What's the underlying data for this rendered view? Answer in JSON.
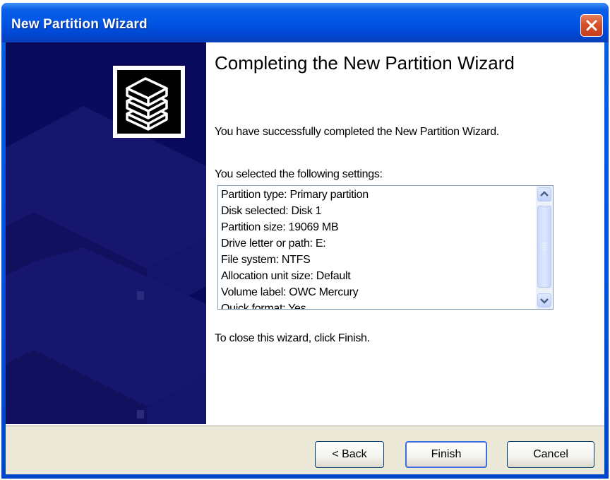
{
  "window": {
    "title": "New Partition Wizard",
    "close_label": "Close"
  },
  "icons": [
    "close-icon",
    "disk-stack-icon",
    "scroll-up-icon",
    "scroll-down-icon"
  ],
  "colors": {
    "titlebar": "#0055e5",
    "banner": "#0a0a5c",
    "footer": "#ece9d8",
    "close_button": "#d8502a"
  },
  "main": {
    "heading": "Completing the New Partition Wizard",
    "success_text": "You have successfully completed the New Partition Wizard.",
    "settings_label": "You selected the following settings:",
    "settings": [
      "Partition type: Primary partition",
      "Disk selected: Disk 1",
      "Partition size: 19069 MB",
      "Drive letter or path: E:",
      "File system: NTFS",
      "Allocation unit size: Default",
      "Volume label: OWC Mercury",
      "Quick format: Yes"
    ],
    "close_instruction": "To close this wizard, click Finish."
  },
  "footer": {
    "back_label": "< Back",
    "finish_label": "Finish",
    "cancel_label": "Cancel"
  }
}
